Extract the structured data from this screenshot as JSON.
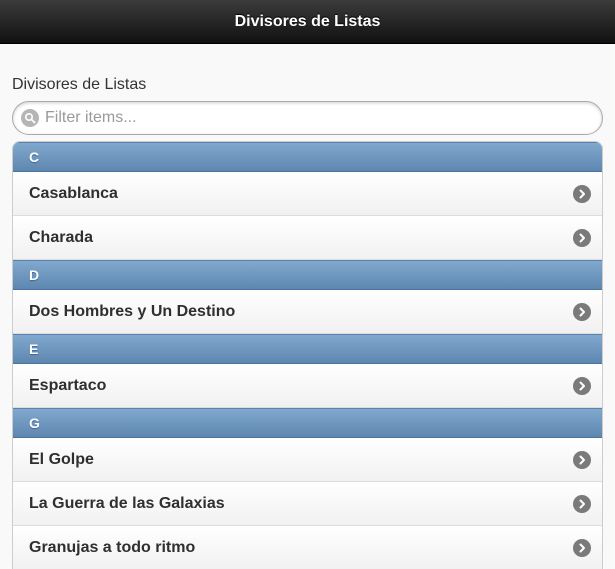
{
  "header": {
    "title": "Divisores de Listas"
  },
  "list": {
    "title": "Divisores de Listas",
    "filter_placeholder": "Filter items...",
    "groups": [
      {
        "letter": "C",
        "items": [
          "Casablanca",
          "Charada"
        ]
      },
      {
        "letter": "D",
        "items": [
          "Dos Hombres y Un Destino"
        ]
      },
      {
        "letter": "E",
        "items": [
          "Espartaco"
        ]
      },
      {
        "letter": "G",
        "items": [
          "El Golpe",
          "La Guerra de las Galaxias",
          "Granujas a todo ritmo"
        ]
      }
    ]
  },
  "icons": {
    "search": "search-icon",
    "arrow": "arrow-right-icon"
  },
  "colors": {
    "divider": "#6b93bc",
    "header": "#1e1e1e"
  }
}
